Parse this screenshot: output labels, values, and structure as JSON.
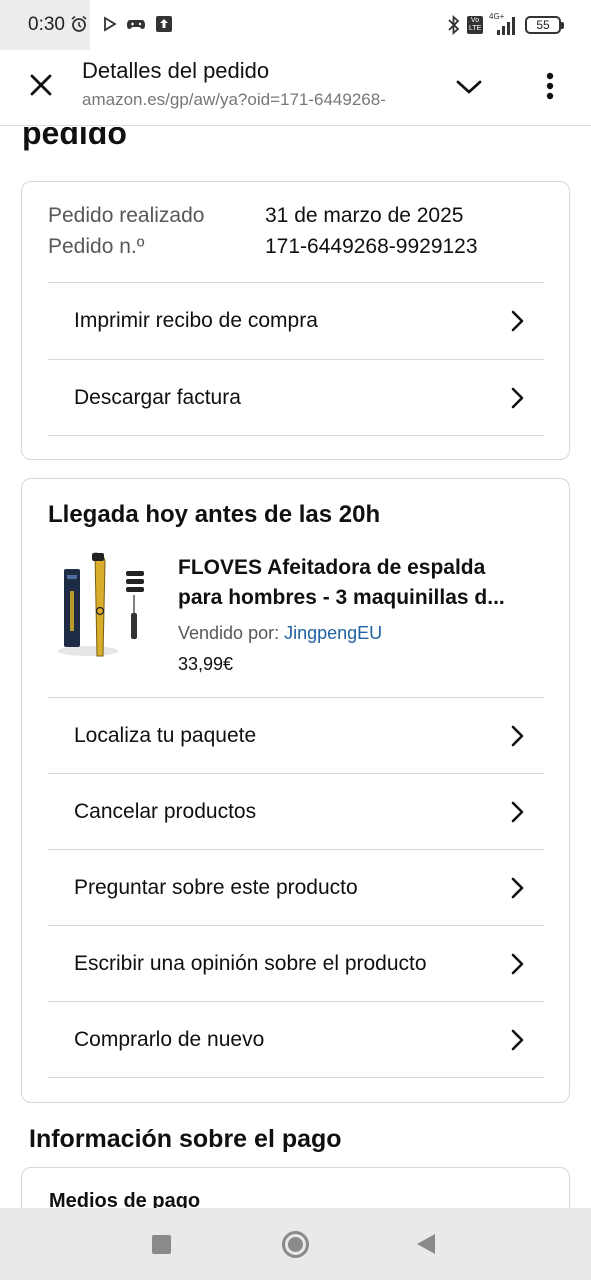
{
  "status_bar": {
    "time": "0:30",
    "battery": "55",
    "network": "4G+",
    "lte_badge": "Vo LTE"
  },
  "browser": {
    "title": "Detalles del pedido",
    "url": "amazon.es/gp/aw/ya?oid=171-6449268-"
  },
  "page": {
    "heading_partial": "pedido",
    "order_info": {
      "placed_label": "Pedido realizado",
      "placed_value": "31 de marzo de 2025",
      "number_label": "Pedido n.º",
      "number_value": "171-6449268-9929123",
      "actions": [
        "Imprimir recibo de compra",
        "Descargar factura"
      ]
    },
    "shipment": {
      "title": "Llegada hoy antes de las 20h",
      "product": {
        "title_line1": "FLOVES Afeitadora de espalda",
        "title_line2": "para hombres - 3 maquinillas d...",
        "seller_label": "Vendido por: ",
        "seller_name": "JingpengEU",
        "price": "33,99€"
      },
      "actions": [
        "Localiza tu paquete",
        "Cancelar productos",
        "Preguntar sobre este producto",
        "Escribir una opinión sobre el producto",
        "Comprarlo de nuevo"
      ]
    },
    "payment": {
      "heading": "Información sobre el pago",
      "methods_label": "Medios de pago"
    }
  },
  "colors": {
    "link": "#2162a1",
    "border": "#d5d9d9",
    "text": "#0f1111",
    "muted": "#565959"
  }
}
